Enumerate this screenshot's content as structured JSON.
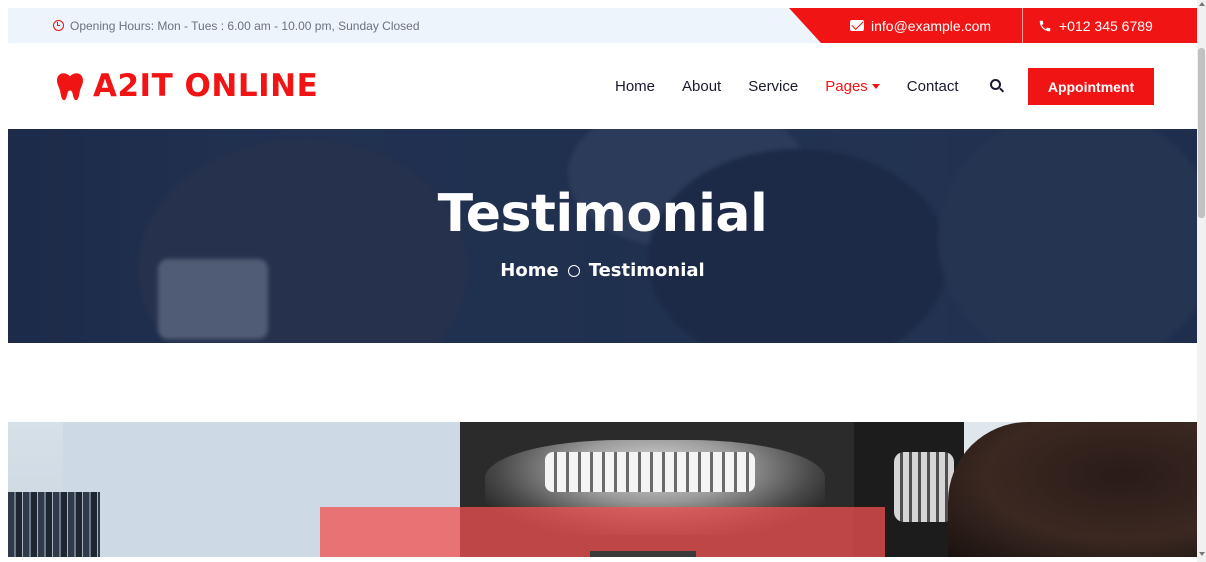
{
  "topbar": {
    "hours_text": "Opening Hours: Mon - Tues : 6.00 am - 10.00 pm, Sunday Closed",
    "email": "info@example.com",
    "phone": "+012 345 6789"
  },
  "brand": {
    "name": "A2IT ONLINE",
    "accent_color": "#f01414"
  },
  "nav": {
    "items": [
      {
        "label": "Home"
      },
      {
        "label": "About"
      },
      {
        "label": "Service"
      },
      {
        "label": "Pages",
        "active": true
      },
      {
        "label": "Contact"
      }
    ],
    "appointment_label": "Appointment"
  },
  "hero": {
    "title": "Testimonial",
    "breadcrumb": [
      "Home",
      "Testimonial"
    ]
  },
  "icons": {
    "clock": "clock-icon",
    "mail": "envelope-icon",
    "phone": "phone-icon",
    "logo": "tooth-icon",
    "search": "search-icon",
    "caret": "caret-down-icon",
    "breadcrumb_separator": "circle-icon"
  }
}
